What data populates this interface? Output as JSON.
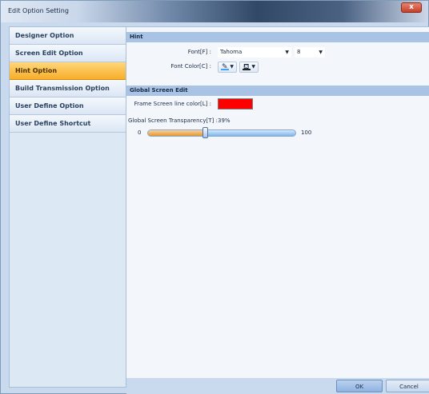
{
  "window": {
    "title": "Edit Option Setting",
    "close_glyph": "x"
  },
  "sidebar": {
    "items": [
      {
        "label": "Designer Option"
      },
      {
        "label": "Screen Edit Option"
      },
      {
        "label": "Hint Option"
      },
      {
        "label": "Build Transmission Option"
      },
      {
        "label": "User Define Option"
      },
      {
        "label": "User Define Shortcut"
      }
    ],
    "selected": "Hint Option"
  },
  "hint": {
    "header": "Hint",
    "font_label": "Font[F] :",
    "font_value": "Tahoma",
    "size_value": "8",
    "font_color_label": "Font Color[C] :",
    "pen_icon": "pen-icon",
    "fill_icon": "paint-bucket-icon",
    "pen_color": "#3fa0ff",
    "fill_color": "#222222"
  },
  "global": {
    "header": "Global Screen Edit",
    "frame_label": "Frame Screen line color[L] :",
    "frame_color": "#ff0000",
    "transparency_label": "Global Screen Transparency[T] :",
    "transparency_value": "39%",
    "slider_min": "0",
    "slider_max": "100",
    "slider_level": 39
  },
  "buttons": {
    "ok": "OK",
    "cancel": "Cancel"
  }
}
